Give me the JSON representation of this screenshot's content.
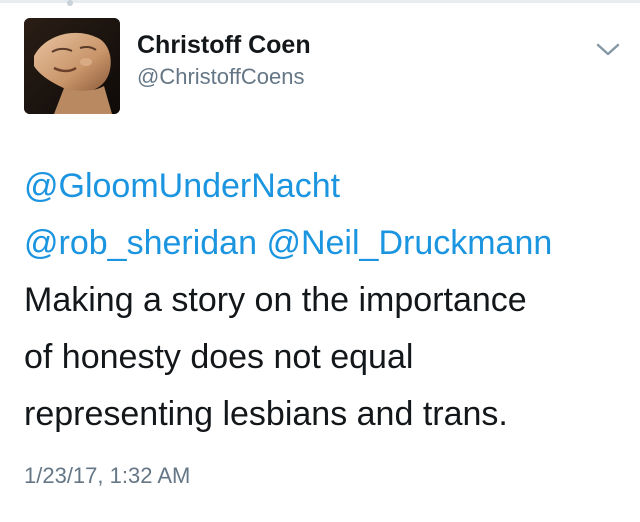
{
  "tweet": {
    "author": {
      "display_name": "Christoff Coen",
      "handle": "@ChristoffCoens"
    },
    "mentions": {
      "first": "@GloomUnderNacht",
      "second": "@rob_sheridan",
      "third": "@Neil_Druckmann"
    },
    "text_lines": [
      "Making a story on the importance",
      "of honesty does not equal",
      "representing lesbians and trans."
    ],
    "timestamp": "1/23/17, 1:32 AM"
  },
  "icons": {
    "menu": "chevron-down-icon"
  },
  "colors": {
    "link": "#1b95e0",
    "secondary_text": "#657786",
    "primary_text": "#14171a"
  }
}
